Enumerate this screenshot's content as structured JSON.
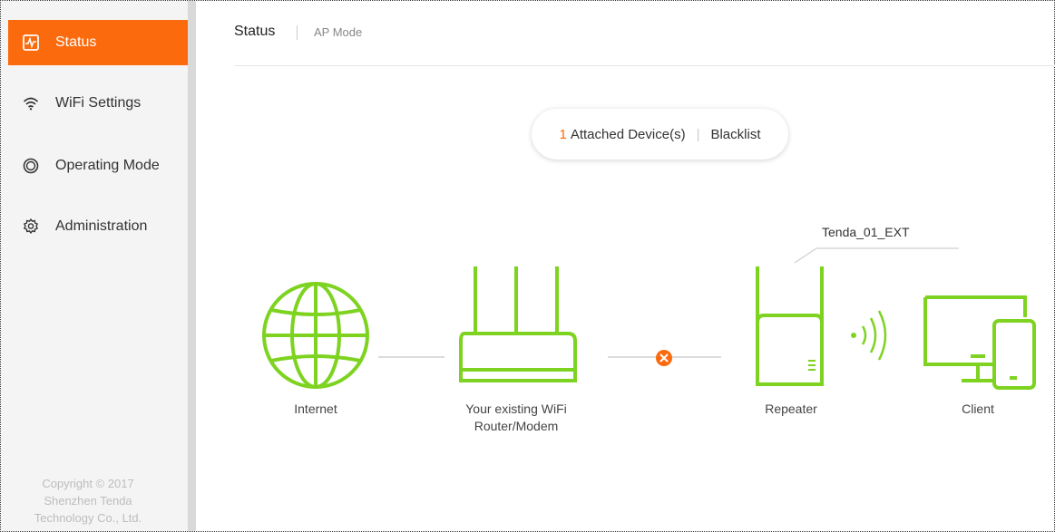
{
  "sidebar": {
    "items": [
      {
        "label": "Status",
        "icon": "status-pulse-icon",
        "active": true
      },
      {
        "label": "WiFi Settings",
        "icon": "wifi-icon",
        "active": false
      },
      {
        "label": "Operating Mode",
        "icon": "operating-mode-icon",
        "active": false
      },
      {
        "label": "Administration",
        "icon": "gear-icon",
        "active": false
      }
    ],
    "copyright": [
      "Copyright © 2017",
      "Shenzhen Tenda",
      "Technology Co., Ltd."
    ]
  },
  "header": {
    "title": "Status",
    "subtitle": "AP Mode"
  },
  "devices": {
    "count": "1",
    "attached_label": "Attached Device(s)",
    "blacklist_label": "Blacklist"
  },
  "topology": {
    "ssid": "Tenda_01_EXT",
    "internet_label": "Internet",
    "router_label_line1": "Your existing WiFi",
    "router_label_line2": "Router/Modem",
    "repeater_label": "Repeater",
    "client_label": "Client",
    "connection_status": "disconnected"
  },
  "colors": {
    "accent": "#fb6a0d",
    "device_green": "#7ed321",
    "error": "#fb6a0d"
  }
}
